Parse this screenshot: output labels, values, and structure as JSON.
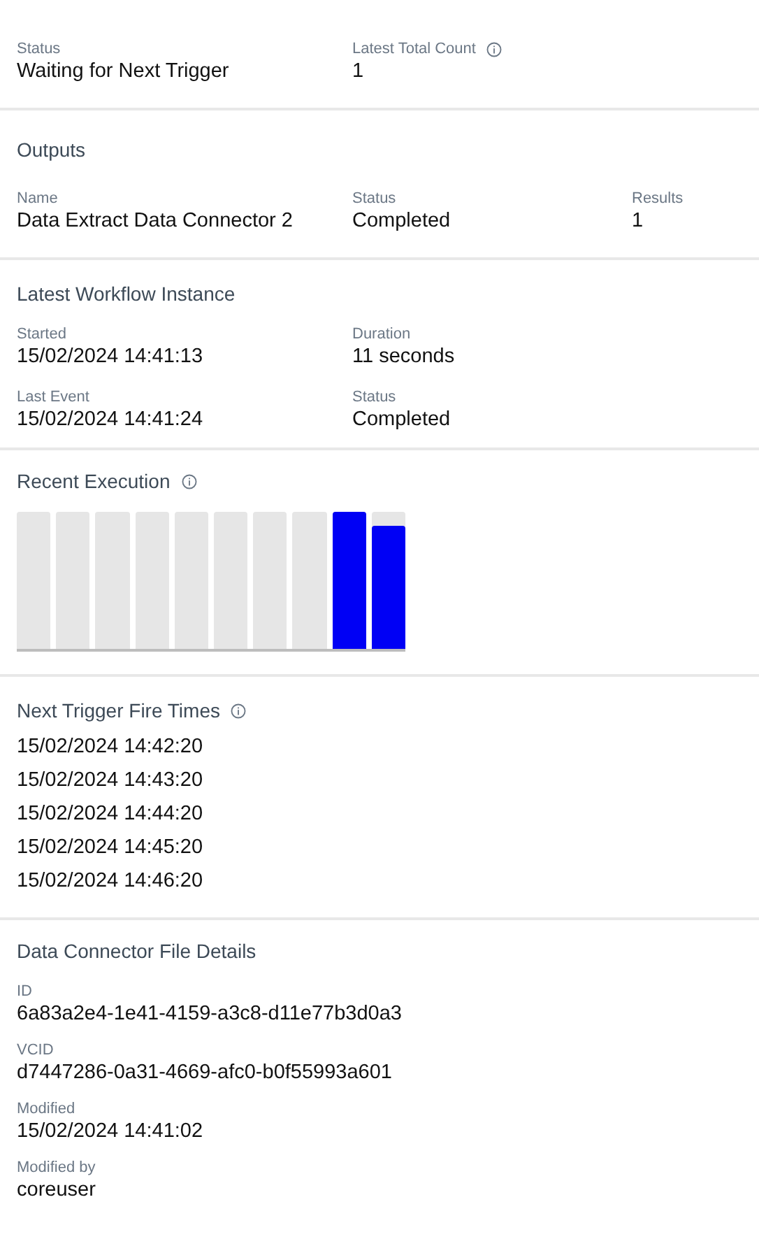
{
  "summary": {
    "fields": [
      {
        "label": "Status",
        "value": "Waiting for Next Trigger",
        "info": false
      },
      {
        "label": "Latest Total Count",
        "value": "1",
        "info": true
      }
    ]
  },
  "outputs": {
    "title": "Outputs",
    "columns": [
      "Name",
      "Status",
      "Results"
    ],
    "rows": [
      [
        "Data Extract Data Connector 2",
        "Completed",
        "1"
      ]
    ]
  },
  "latest_workflow_instance": {
    "title": "Latest Workflow Instance",
    "fields": [
      {
        "label": "Started",
        "value": "15/02/2024 14:41:13"
      },
      {
        "label": "Duration",
        "value": "11 seconds"
      },
      {
        "label": "Last Event",
        "value": "15/02/2024 14:41:24"
      },
      {
        "label": "Status",
        "value": "Completed"
      }
    ]
  },
  "recent_execution": {
    "title": "Recent Execution",
    "info": true,
    "bars": [
      {
        "level": 0
      },
      {
        "level": 0
      },
      {
        "level": 0
      },
      {
        "level": 0
      },
      {
        "level": 0
      },
      {
        "level": 0
      },
      {
        "level": 0
      },
      {
        "level": 0
      },
      {
        "level": 1
      },
      {
        "level": 0.9
      }
    ]
  },
  "next_trigger_fire_times": {
    "title": "Next Trigger Fire Times",
    "info": true,
    "times": [
      "15/02/2024 14:42:20",
      "15/02/2024 14:43:20",
      "15/02/2024 14:44:20",
      "15/02/2024 14:45:20",
      "15/02/2024 14:46:20"
    ]
  },
  "data_connector_file_details": {
    "title": "Data Connector File Details",
    "fields": [
      {
        "label": "ID",
        "value": "6a83a2e4-1e41-4159-a3c8-d11e77b3d0a3"
      },
      {
        "label": "VCID",
        "value": "d7447286-0a31-4669-afc0-b0f55993a601"
      },
      {
        "label": "Modified",
        "value": "15/02/2024 14:41:02"
      },
      {
        "label": "Modified by",
        "value": "coreuser"
      }
    ]
  }
}
